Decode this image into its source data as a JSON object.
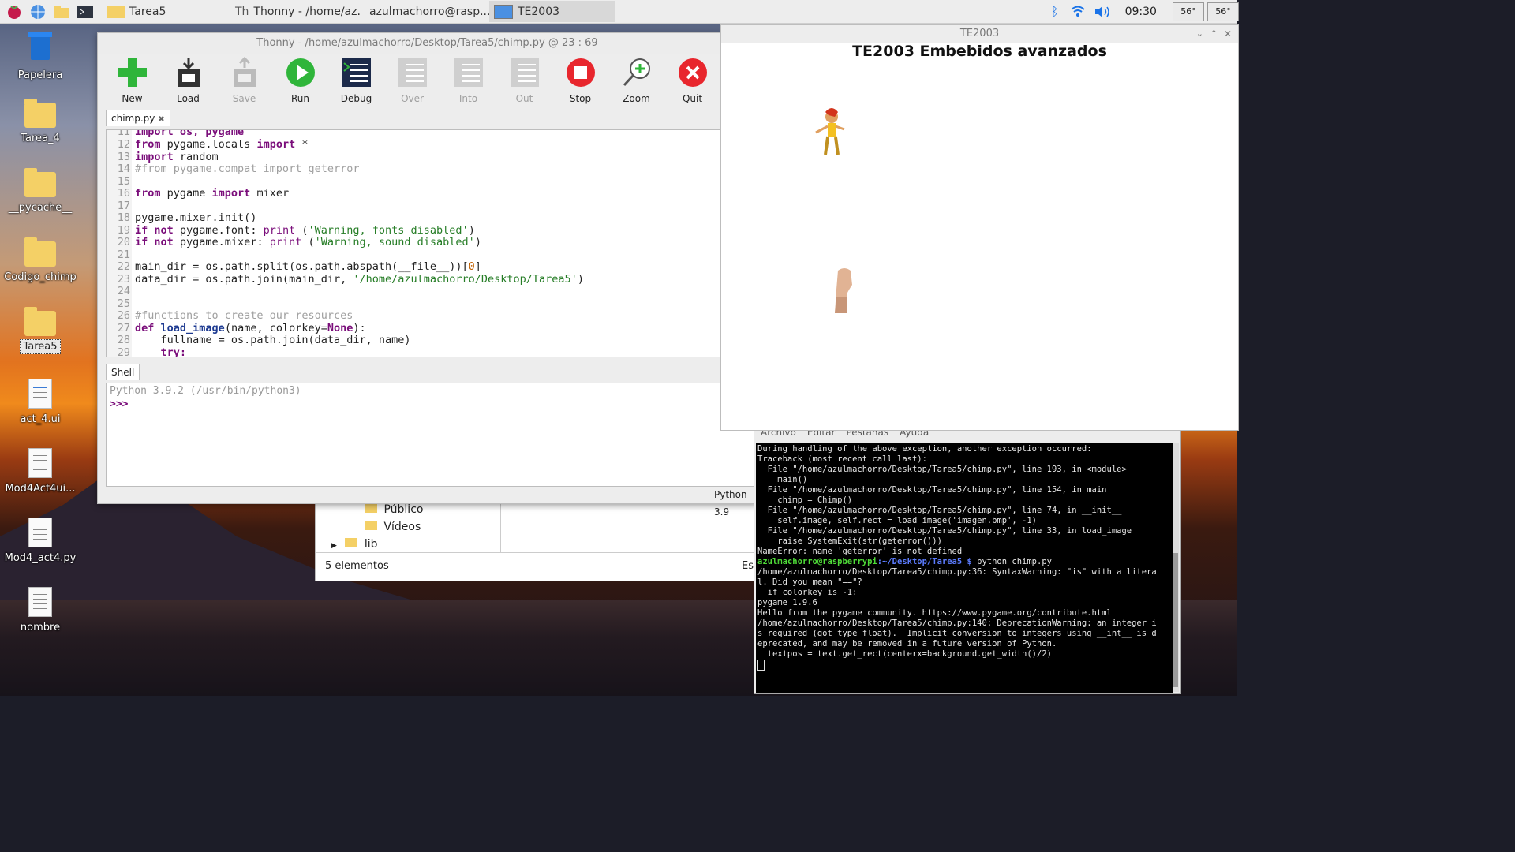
{
  "taskbar": {
    "tasks": [
      "Tarea5",
      "Thonny  -  /home/az...",
      "azulmachorro@rasp...",
      "TE2003"
    ],
    "clock": "09:30",
    "cpu": [
      "56°",
      "56°"
    ]
  },
  "desktop": {
    "icons": [
      "Papelera",
      "Tarea_4",
      "__pycache__",
      "Codigo_chimp",
      "Tarea5",
      "act_4.ui",
      "Mod4Act4ui...",
      "Mod4_act4.py",
      "nombre"
    ]
  },
  "thonny": {
    "title": "Thonny  -  /home/azulmachorro/Desktop/Tarea5/chimp.py  @  23 : 69",
    "tools": [
      "New",
      "Load",
      "Save",
      "Run",
      "Debug",
      "Over",
      "Into",
      "Out",
      "Stop",
      "Zoom",
      "Quit"
    ],
    "editor_tab": "chimp.py",
    "close_glyph": "✖",
    "shell_tab": "Shell",
    "shell_banner": "Python 3.9.2 (/usr/bin/python3)",
    "shell_prompt": ">>>",
    "status": "Python 3.9"
  },
  "code": {
    "line11": [
      "11",
      "import os, pygame"
    ],
    "line12": [
      "12",
      "from",
      " pygame.locals ",
      "import",
      " *"
    ],
    "line13": [
      "13",
      "import",
      " random"
    ],
    "line14": [
      "14",
      "#from pygame.compat import geterror"
    ],
    "line15": [
      "15"
    ],
    "line16": [
      "16",
      "from",
      " pygame ",
      "import",
      " mixer"
    ],
    "line17": [
      "17"
    ],
    "line18": [
      "18",
      "pygame.mixer.init()"
    ],
    "line19": [
      "19",
      "if not",
      " pygame.font: ",
      "print",
      " (",
      "'Warning, fonts disabled'",
      ")"
    ],
    "line20": [
      "20",
      "if not",
      " pygame.mixer: ",
      "print",
      " (",
      "'Warning, sound disabled'",
      ")"
    ],
    "line21": [
      "21"
    ],
    "line22": [
      "22",
      "main_dir = os.path.split(os.path.abspath(__file__))[",
      "0",
      "]"
    ],
    "line23": [
      "23",
      "data_dir = os.path.join(main_dir, ",
      "'/home/azulmachorro/Desktop/Tarea5'",
      ")"
    ],
    "line24": [
      "24"
    ],
    "line25": [
      "25"
    ],
    "line26": [
      "26",
      "#functions to create our resources"
    ],
    "line27": [
      "27",
      "def",
      " ",
      "load_image",
      "(name, colorkey=",
      "None",
      "):"
    ],
    "line28": [
      "28",
      "    fullname = os.path.join(data_dir, name)"
    ],
    "line29": [
      "29",
      "    try:"
    ]
  },
  "filemgr": {
    "items": [
      "Público",
      "Vídeos",
      "lib"
    ],
    "count": "5 elementos",
    "right_edge": "Es"
  },
  "terminal": {
    "menu": [
      "Archivo",
      "Editar",
      "Pestañas",
      "Ayuda"
    ],
    "lines": [
      "During handling of the above exception, another exception occurred:",
      "",
      "Traceback (most recent call last):",
      "  File \"/home/azulmachorro/Desktop/Tarea5/chimp.py\", line 193, in <module>",
      "    main()",
      "  File \"/home/azulmachorro/Desktop/Tarea5/chimp.py\", line 154, in main",
      "    chimp = Chimp()",
      "  File \"/home/azulmachorro/Desktop/Tarea5/chimp.py\", line 74, in __init__",
      "    self.image, self.rect = load_image('imagen.bmp', -1)",
      "  File \"/home/azulmachorro/Desktop/Tarea5/chimp.py\", line 33, in load_image",
      "    raise SystemExit(str(geterror()))",
      "NameError: name 'geterror' is not defined"
    ],
    "prompt_user": "azulmachorro@raspberrypi",
    "prompt_path": ":~/Desktop/Tarea5 $",
    "prompt_cmd": " python chimp.py",
    "lines2": [
      "/home/azulmachorro/Desktop/Tarea5/chimp.py:36: SyntaxWarning: \"is\" with a litera",
      "l. Did you mean \"==\"?",
      "  if colorkey is -1:",
      "pygame 1.9.6",
      "Hello from the pygame community. https://www.pygame.org/contribute.html",
      "/home/azulmachorro/Desktop/Tarea5/chimp.py:140: DeprecationWarning: an integer i",
      "s required (got type float).  Implicit conversion to integers using __int__ is d",
      "eprecated, and may be removed in a future version of Python.",
      "  textpos = text.get_rect(centerx=background.get_width()/2)"
    ]
  },
  "pygame": {
    "window_title": "TE2003",
    "heading": "TE2003 Embebidos avanzados"
  }
}
